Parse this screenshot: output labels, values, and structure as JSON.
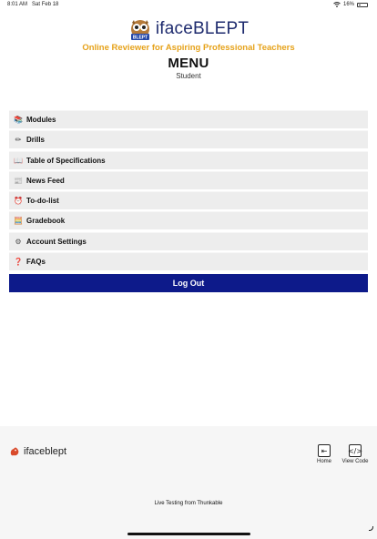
{
  "status_bar": {
    "time": "8:01 AM",
    "date": "Sat Feb 18",
    "battery": "16%"
  },
  "header": {
    "logo_text": "BLEPT",
    "brand": "ifaceBLEPT",
    "tagline": "Online Reviewer for Aspiring Professional Teachers",
    "menu_title": "MENU",
    "role": "Student"
  },
  "menu": {
    "items": [
      {
        "label": "Modules",
        "icon": "books-icon",
        "glyph": "📚",
        "color": "#6b4a2a"
      },
      {
        "label": "Drills",
        "icon": "pen-icon",
        "glyph": "✏",
        "color": "#333333"
      },
      {
        "label": "Table of Specifications",
        "icon": "open-book-icon",
        "glyph": "📖",
        "color": "#555555"
      },
      {
        "label": "News Feed",
        "icon": "newspaper-icon",
        "glyph": "📰",
        "color": "#555555"
      },
      {
        "label": "To-do-list",
        "icon": "alarm-clock-icon",
        "glyph": "⏰",
        "color": "#d22b2b"
      },
      {
        "label": "Gradebook",
        "icon": "abacus-icon",
        "glyph": "🧮",
        "color": "#a0522d"
      },
      {
        "label": "Account Settings",
        "icon": "gear-icon",
        "glyph": "⚙",
        "color": "#555555"
      },
      {
        "label": "FAQs",
        "icon": "question-mark-icon",
        "glyph": "❓",
        "color": "#d22b2b"
      }
    ],
    "logout_label": "Log Out"
  },
  "bottom": {
    "app_name": "ifaceblept",
    "home_label": "Home",
    "view_code_label": "View Code",
    "live_text": "Live Testing from Thunkable"
  },
  "colors": {
    "brand_blue": "#1e2b6e",
    "tagline_gold": "#e6a21a",
    "logout_bg": "#0d1a8a",
    "item_bg": "#ededed"
  }
}
